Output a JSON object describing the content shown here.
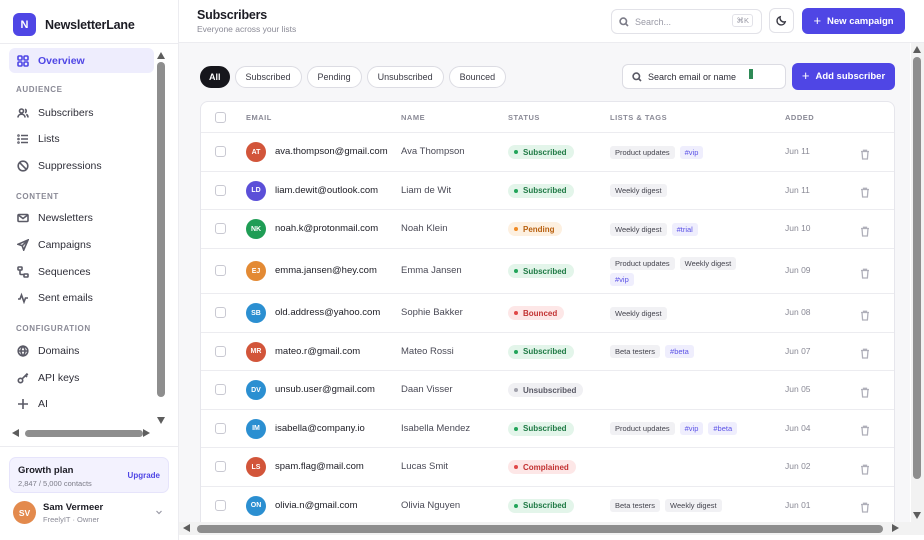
{
  "brand": {
    "logo_letter": "N",
    "name": "NewsletterLane"
  },
  "sidebar": {
    "overview": "Overview",
    "sections": {
      "audience": "AUDIENCE",
      "content": "CONTENT",
      "configuration": "CONFIGURATION"
    },
    "items": {
      "subscribers": "Subscribers",
      "lists": "Lists",
      "suppressions": "Suppressions",
      "newsletters": "Newsletters",
      "campaigns": "Campaigns",
      "sequences": "Sequences",
      "sent_emails": "Sent emails",
      "domains": "Domains",
      "api_keys": "API keys",
      "ai": "AI"
    },
    "plan": {
      "title": "Growth plan",
      "usage": "2,847 / 5,000 contacts",
      "upgrade": "Upgrade"
    },
    "user": {
      "initials": "SV",
      "name": "Sam Vermeer",
      "org": "FreelyIT · Owner"
    }
  },
  "header": {
    "title": "Subscribers",
    "subtitle": "Everyone across your lists",
    "search_placeholder": "Search...",
    "search_shortcut": "⌘K",
    "new_campaign": "New campaign"
  },
  "filters": [
    "All",
    "Subscribed",
    "Pending",
    "Unsubscribed",
    "Bounced"
  ],
  "active_filter": "All",
  "table_search": {
    "value": "Search email or name"
  },
  "add_subscriber": "Add subscriber",
  "columns": {
    "email": "EMAIL",
    "name": "NAME",
    "status": "STATUS",
    "lists": "LISTS & TAGS",
    "added": "ADDED"
  },
  "status_colors": {
    "Subscribed": {
      "bg": "#e3f5ea",
      "fg": "#1f7a45",
      "dot": "#22a55a"
    },
    "Pending": {
      "bg": "#fdf0e0",
      "fg": "#b8600f",
      "dot": "#f08a24"
    },
    "Bounced": {
      "bg": "#fde7e7",
      "fg": "#c23232",
      "dot": "#e04848"
    },
    "Unsubscribed": {
      "bg": "#f0f0f3",
      "fg": "#5a5a66",
      "dot": "#a3a3ad"
    },
    "Complained": {
      "bg": "#fde7e7",
      "fg": "#c23232",
      "dot": "#e04848"
    }
  },
  "rows": [
    {
      "initials": "AT",
      "color": "#d2553a",
      "email": "ava.thompson@gmail.com",
      "name": "Ava Thompson",
      "status": "Subscribed",
      "tags": [
        "Product updates",
        "#vip"
      ],
      "added": "Jun 11"
    },
    {
      "initials": "LD",
      "color": "#5b4fd8",
      "email": "liam.dewit@outlook.com",
      "name": "Liam de Wit",
      "status": "Subscribed",
      "tags": [
        "Weekly digest"
      ],
      "added": "Jun 11"
    },
    {
      "initials": "NK",
      "color": "#1f9d55",
      "email": "noah.k@protonmail.com",
      "name": "Noah Klein",
      "status": "Pending",
      "tags": [
        "Weekly digest",
        "#trial"
      ],
      "added": "Jun 10"
    },
    {
      "initials": "EJ",
      "color": "#e38a34",
      "email": "emma.jansen@hey.com",
      "name": "Emma Jansen",
      "status": "Subscribed",
      "tags": [
        "Product updates",
        "Weekly digest",
        "#vip"
      ],
      "added": "Jun 09"
    },
    {
      "initials": "SB",
      "color": "#2b8fd1",
      "email": "old.address@yahoo.com",
      "name": "Sophie Bakker",
      "status": "Bounced",
      "tags": [
        "Weekly digest"
      ],
      "added": "Jun 08"
    },
    {
      "initials": "MR",
      "color": "#d2553a",
      "email": "mateo.r@gmail.com",
      "name": "Mateo Rossi",
      "status": "Subscribed",
      "tags": [
        "Beta testers",
        "#beta"
      ],
      "added": "Jun 07"
    },
    {
      "initials": "DV",
      "color": "#2b8fd1",
      "email": "unsub.user@gmail.com",
      "name": "Daan Visser",
      "status": "Unsubscribed",
      "tags": [],
      "added": "Jun 05"
    },
    {
      "initials": "IM",
      "color": "#2b8fd1",
      "email": "isabella@company.io",
      "name": "Isabella Mendez",
      "status": "Subscribed",
      "tags": [
        "Product updates",
        "#vip",
        "#beta"
      ],
      "added": "Jun 04"
    },
    {
      "initials": "LS",
      "color": "#d2553a",
      "email": "spam.flag@mail.com",
      "name": "Lucas Smit",
      "status": "Complained",
      "tags": [],
      "added": "Jun 02"
    },
    {
      "initials": "ON",
      "color": "#2b8fd1",
      "email": "olivia.n@gmail.com",
      "name": "Olivia Nguyen",
      "status": "Subscribed",
      "tags": [
        "Beta testers",
        "Weekly digest"
      ],
      "added": "Jun 01"
    }
  ]
}
